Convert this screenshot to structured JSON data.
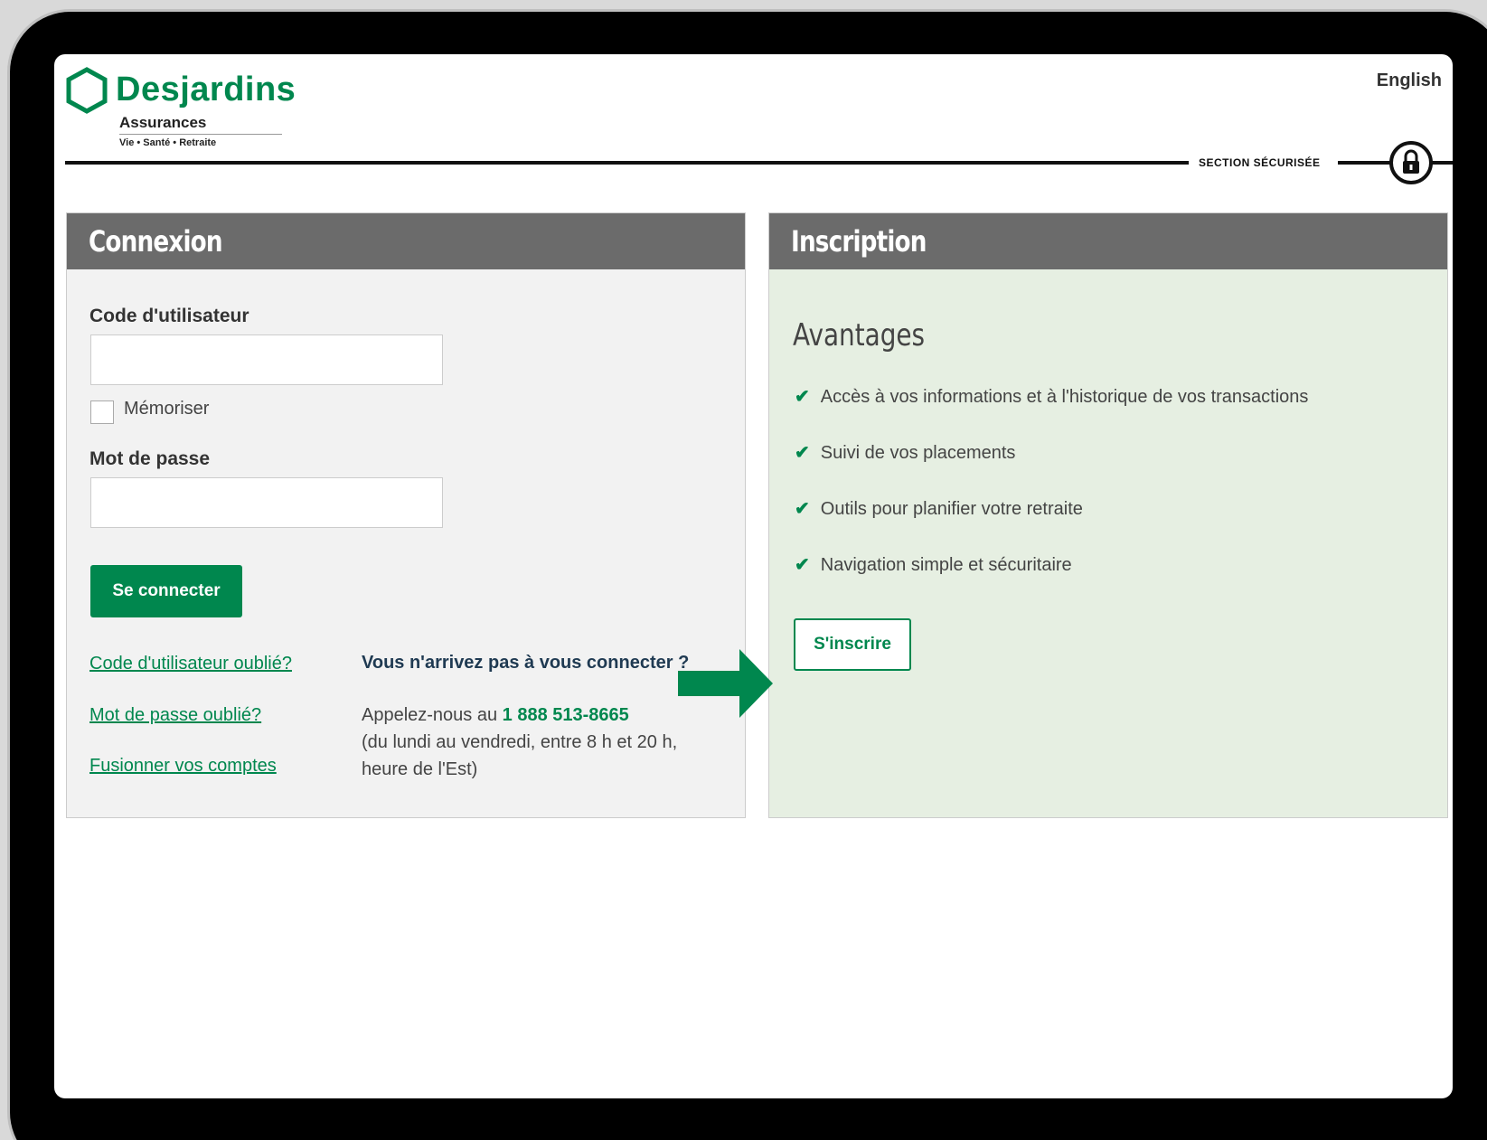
{
  "header": {
    "brand_name": "Desjardins",
    "brand_sub": "Assurances",
    "brand_tagline": "Vie • Santé • Retraite",
    "language_link": "English",
    "secure_label": "SECTION SÉCURISÉE"
  },
  "login": {
    "title": "Connexion",
    "username_label": "Code d'utilisateur",
    "username_value": "",
    "remember_label": "Mémoriser",
    "password_label": "Mot de passe",
    "password_value": "",
    "submit_label": "Se connecter",
    "links": [
      "Code d'utilisateur oublié?",
      "Mot de passe oublié?",
      "Fusionner vos comptes"
    ],
    "help_title": "Vous n'arrivez pas à vous connecter ?",
    "help_prefix": "Appelez-nous au ",
    "help_phone": "1 888 513-8665",
    "help_hours": "(du lundi au vendredi, entre 8 h et 20 h, heure de l'Est)"
  },
  "signup": {
    "title": "Inscription",
    "advantages_title": "Avantages",
    "benefits": [
      "Accès à vos informations et à l'historique de vos transactions",
      "Suivi de vos placements",
      "Outils pour planifier votre retraite",
      "Navigation simple et sécuritaire"
    ],
    "submit_label": "S'inscrire"
  },
  "colors": {
    "brand_green": "#00874e",
    "panel_header": "#6b6b6b",
    "signup_bg": "#e6efe2"
  },
  "icons": [
    "desjardins-hexagon-icon",
    "lock-icon",
    "check-icon",
    "arrow-right-icon"
  ]
}
